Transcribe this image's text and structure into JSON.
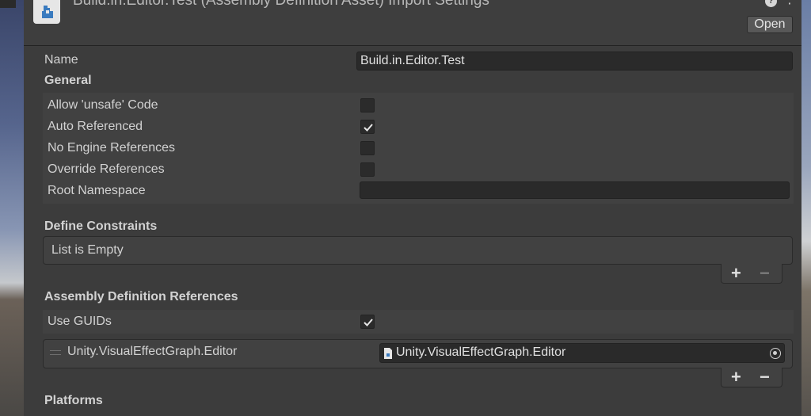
{
  "header": {
    "title": "Build.in.Editor.Test (Assembly Definition Asset) Import Settings",
    "open_label": "Open",
    "help_glyph": "?",
    "menu_glyph": "⋮"
  },
  "name_field": {
    "label": "Name",
    "value": "Build.in.Editor.Test"
  },
  "general": {
    "title": "General",
    "options": [
      {
        "label": "Allow 'unsafe' Code",
        "checked": false
      },
      {
        "label": "Auto Referenced",
        "checked": true
      },
      {
        "label": "No Engine References",
        "checked": false
      },
      {
        "label": "Override References",
        "checked": false
      }
    ],
    "root_namespace": {
      "label": "Root Namespace",
      "value": ""
    }
  },
  "define_constraints": {
    "title": "Define Constraints",
    "empty_text": "List is Empty",
    "add_glyph": "+",
    "remove_glyph": "−"
  },
  "assembly_refs": {
    "title": "Assembly Definition References",
    "use_guids": {
      "label": "Use GUIDs",
      "checked": true
    },
    "items": [
      {
        "name": "Unity.VisualEffectGraph.Editor",
        "object": "Unity.VisualEffectGraph.Editor"
      }
    ],
    "add_glyph": "+",
    "remove_glyph": "−"
  },
  "platforms": {
    "title": "Platforms"
  },
  "icons": {
    "header": "assembly-definition-icon",
    "check": "checkmark-icon",
    "file": "file-icon",
    "picker": "object-picker-icon"
  },
  "colors": {
    "panel": "#3c3c3c",
    "field": "#2a2a2a",
    "text": "#d2d2d2",
    "button": "#585858"
  }
}
